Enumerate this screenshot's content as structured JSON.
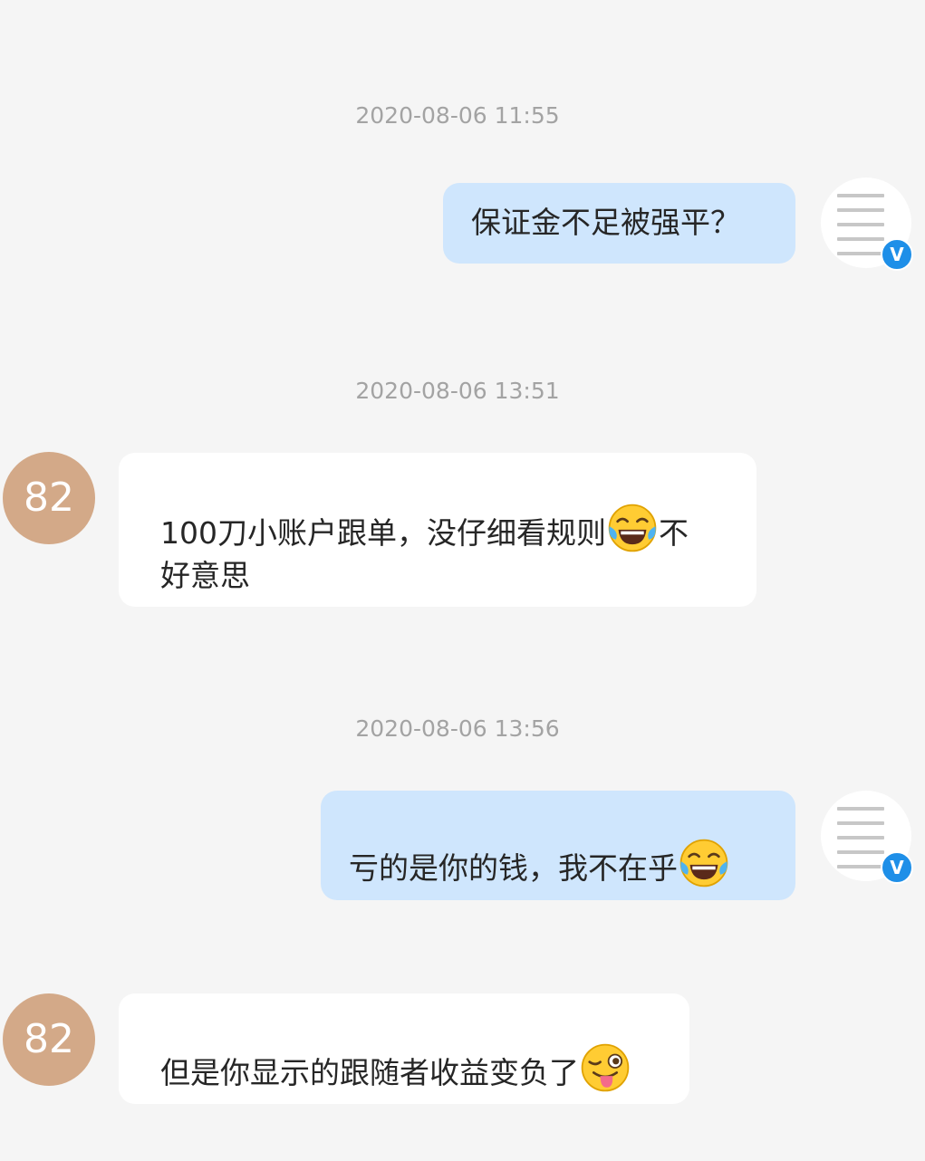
{
  "messages": [
    {
      "timestamp": "2020-08-06 11:55",
      "sender": "me",
      "text": "保证金不足被强平？"
    },
    {
      "timestamp": "2020-08-06 13:51",
      "sender": "them",
      "avatar_label": "82",
      "text_line1": "100刀小账户跟单，没仔细看规则",
      "text_after_emoji": "不",
      "text_line2": "好意思",
      "emoji": "tears-of-joy"
    },
    {
      "timestamp": "2020-08-06 13:56",
      "sender": "me",
      "text": "亏的是你的钱，我不在乎",
      "emoji": "tears-of-joy"
    },
    {
      "sender": "them",
      "avatar_label": "82",
      "text": "但是你显示的跟随者收益变负了",
      "emoji": "winking-tongue"
    }
  ],
  "colors": {
    "background": "#f5f5f5",
    "my_bubble": "#cfe6fd",
    "their_bubble": "#ffffff",
    "avatar_82": "#d3a988",
    "verified_badge": "#1e8fe8",
    "timestamp_text": "#a3a3a3"
  },
  "icons": {
    "verified_badge": "V"
  }
}
